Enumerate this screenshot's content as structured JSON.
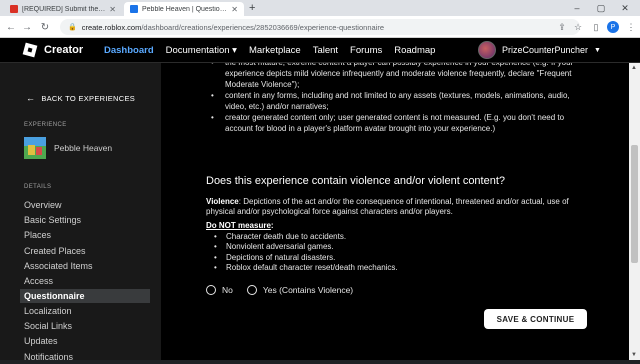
{
  "browser": {
    "tabs": [
      {
        "title": "[REQUIRED] Submit the New Exp",
        "favicon_color": "#d93025",
        "active": false
      },
      {
        "title": "Pebble Heaven | Questionnaire",
        "favicon_color": "#1a73e8",
        "active": true
      }
    ],
    "url_host": "create.roblox.com",
    "url_path": "/dashboard/creations/experiences/2852036669/experience-questionnaire",
    "profile_letter": "P"
  },
  "topnav": {
    "logo_text": "Creator",
    "links": [
      "Dashboard",
      "Documentation ▾",
      "Marketplace",
      "Talent",
      "Forums",
      "Roadmap"
    ],
    "active_link": "Dashboard",
    "username": "PrizeCounterPuncher"
  },
  "sidebar": {
    "back_label": "BACK TO EXPERIENCES",
    "experience_section": "EXPERIENCE",
    "experience_name": "Pebble Heaven",
    "details_section": "DETAILS",
    "items": [
      "Overview",
      "Basic Settings",
      "Places",
      "Created Places",
      "Associated Items",
      "Access",
      "Questionnaire",
      "Localization",
      "Social Links",
      "Updates",
      "Notifications"
    ],
    "active_item": "Questionnaire"
  },
  "content": {
    "top_bullets": [
      "the most mature, extreme content a player can possibly experience in your experience (e.g. If your experience depicts mild violence infrequently and moderate violence frequently, declare \"Frequent Moderate Violence\");",
      "content in any forms, including and not limited to any assets (textures, models, animations, audio, video, etc.) and/or narratives;",
      "creator generated content only; user generated content is not measured. (E.g. you don't need to account for blood in a player's platform avatar brought into your experience.)"
    ],
    "question": "Does this experience contain violence and/or violent content?",
    "violence_term": "Violence",
    "violence_def": ": Depictions of the act and/or the consequence of intentional, threatened and/or actual, use of physical and/or psychological force against characters and/or players.",
    "not_measure": "Do NOT measure",
    "not_measure_colon": ":",
    "exclusions": [
      "Character death due to accidents.",
      "Nonviolent adversarial games.",
      "Depictions of natural disasters.",
      "Roblox default character reset/death mechanics."
    ],
    "options": [
      "No",
      "Yes (Contains Violence)"
    ],
    "save_label": "SAVE & CONTINUE"
  }
}
